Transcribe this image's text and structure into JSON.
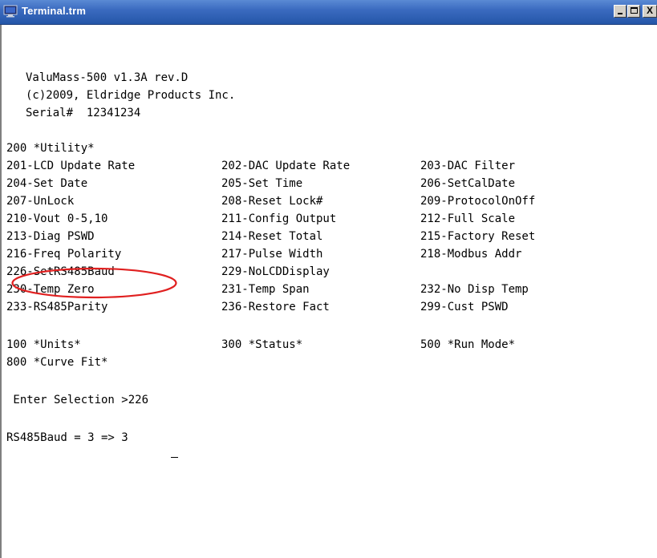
{
  "window": {
    "title": "Terminal.trm",
    "controls": {
      "minimize": "",
      "maximize": "",
      "close": "X"
    }
  },
  "header": {
    "line1": "ValuMass-500 v1.3A rev.D",
    "line2": "(c)2009, Eldridge Products Inc.",
    "line3": "Serial#  12341234"
  },
  "menu": {
    "section_title": "200 *Utility*",
    "rows": [
      [
        "201-LCD Update Rate",
        "202-DAC Update Rate",
        "203-DAC Filter"
      ],
      [
        "204-Set Date",
        "205-Set Time",
        "206-SetCalDate"
      ],
      [
        "207-UnLock",
        "208-Reset Lock#",
        "209-ProtocolOnOff"
      ],
      [
        "210-Vout 0-5,10",
        "211-Config Output",
        "212-Full Scale"
      ],
      [
        "213-Diag PSWD",
        "214-Reset Total",
        "215-Factory Reset"
      ],
      [
        "216-Freq Polarity",
        "217-Pulse Width",
        "218-Modbus Addr"
      ],
      [
        "226-SetRS485Baud",
        "229-NoLCDDisplay",
        ""
      ],
      [
        "230-Temp Zero",
        "231-Temp Span",
        "232-No Disp Temp"
      ],
      [
        "233-RS485Parity",
        "236-Restore Fact",
        "299-Cust PSWD"
      ]
    ],
    "other_modes": [
      [
        "100 *Units*",
        "300 *Status*",
        "500 *Run Mode*"
      ],
      [
        "800 *Curve Fit*",
        "",
        ""
      ]
    ]
  },
  "prompt": {
    "selection": " Enter Selection >226",
    "response": "RS485Baud = 3 => 3"
  },
  "colors": {
    "titlebar": "#3b6bc0",
    "highlight": "#e02020"
  },
  "icons": {
    "app": "terminal-monitor-icon"
  }
}
